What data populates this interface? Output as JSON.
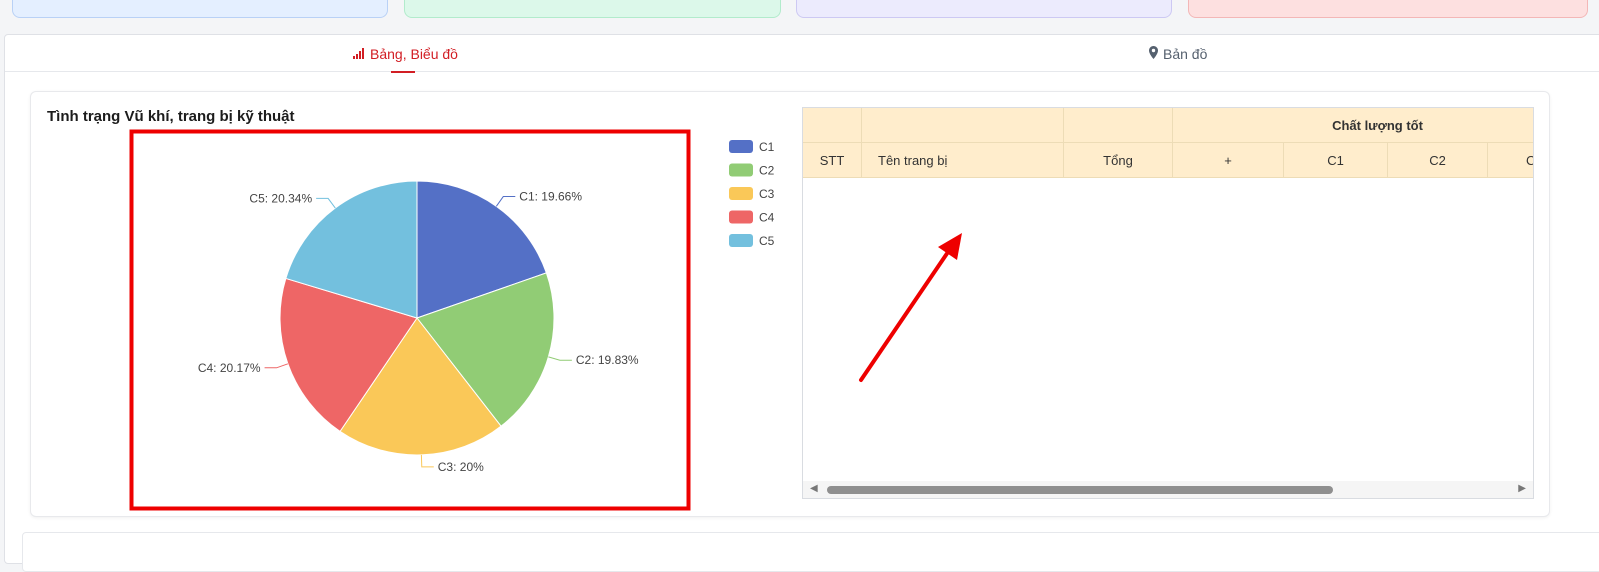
{
  "tabs": {
    "chart_label": "Bảng, Biểu đồ",
    "map_label": "Bản đồ",
    "icons": {
      "chart": "bar-chart-icon",
      "map": "map-marker-icon"
    }
  },
  "card": {
    "title": "Tình trạng Vũ khí, trang bị kỹ thuật"
  },
  "table": {
    "group_header": "Chất lượng tốt",
    "columns": [
      "STT",
      "Tên trang bị",
      "Tổng",
      "+",
      "C1",
      "C2",
      "C"
    ]
  },
  "colors": {
    "accent_red": "#d21e24",
    "table_header_bg": "#ffedcc"
  },
  "chart_data": {
    "type": "pie",
    "title": "",
    "legend_position": "right",
    "slices": [
      {
        "name": "C1",
        "value": 19.66,
        "label": "C1: 19.66%",
        "color": "#5470c6"
      },
      {
        "name": "C2",
        "value": 19.83,
        "label": "C2: 19.83%",
        "color": "#91cc75"
      },
      {
        "name": "C3",
        "value": 20,
        "label": "C3: 20%",
        "color": "#fac858"
      },
      {
        "name": "C4",
        "value": 20.17,
        "label": "C4: 20.17%",
        "color": "#ee6666"
      },
      {
        "name": "C5",
        "value": 20.34,
        "label": "C5: 20.34%",
        "color": "#73c0de"
      }
    ]
  }
}
